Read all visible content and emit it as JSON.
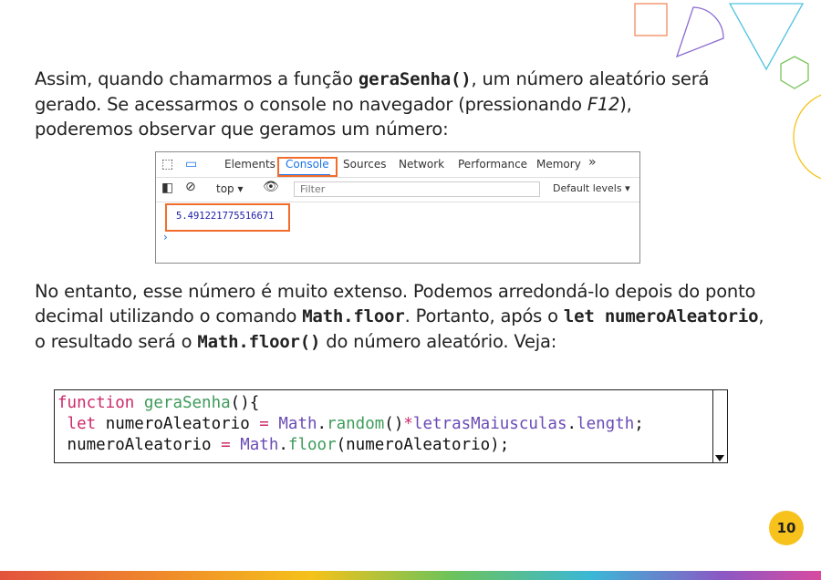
{
  "intro": {
    "part1": "Assim, quando chamarmos a função ",
    "func": "geraSenha()",
    "part2": ", um número aleatório será gerado. Se acessarmos o console no navegador (pressionando ",
    "key": "F12",
    "part3": "), poderemos observar que geramos um número:"
  },
  "devtools": {
    "tabs": [
      "Elements",
      "Console",
      "Sources",
      "Network",
      "Performance",
      "Memory"
    ],
    "more": "»",
    "context": "top ▾",
    "filter_placeholder": "Filter",
    "levels": "Default levels ▾",
    "output": "5.491221775516671",
    "prompt": "›"
  },
  "body": {
    "part1": "No entanto, esse número é muito extenso. Podemos arredondá-lo depois do ponto decimal utilizando o comando ",
    "cmd1": "Math.floor",
    "part2": ". Portanto, após o ",
    "cmd2": "let numeroAleatorio",
    "part3": ", o resultado será o ",
    "cmd3": "Math.floor()",
    "part4": " do número aleatório. Veja:"
  },
  "code": {
    "line1": [
      "function",
      " ",
      "geraSenha",
      "(){"
    ],
    "line2": [
      " ",
      "let",
      " numeroAleatorio ",
      "=",
      " ",
      "Math",
      ".",
      "random",
      "()",
      "*",
      "letrasMaiusculas",
      ".",
      "length",
      ";"
    ],
    "line3": [
      " numeroAleatorio ",
      "=",
      " ",
      "Math",
      ".",
      "floor",
      "(numeroAleatorio);"
    ]
  },
  "page_number": "10",
  "colors": {
    "accent_orange": "#f26d2c",
    "devtools_blue": "#1a73e8",
    "badge_yellow": "#f7c21b"
  }
}
